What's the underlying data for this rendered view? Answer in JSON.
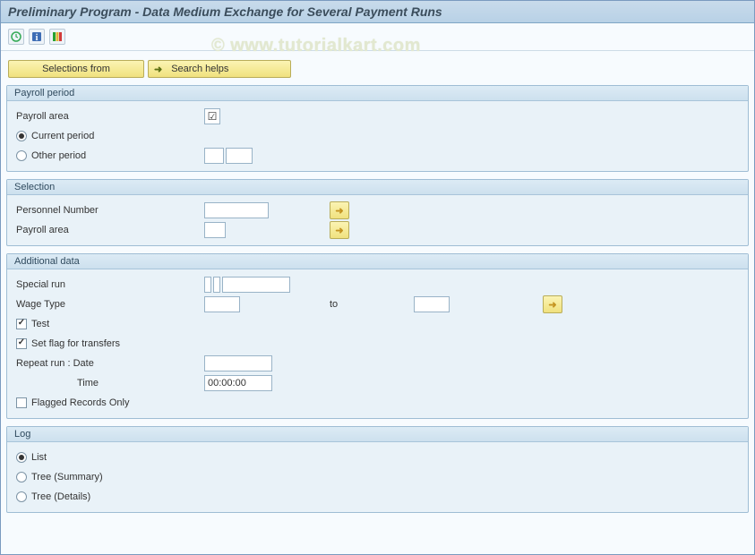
{
  "title": "Preliminary Program - Data Medium Exchange for Several Payment Runs",
  "watermark": "www.tutorialkart.com",
  "buttons": {
    "selectionsFrom": "Selections from",
    "searchHelps": "Search helps"
  },
  "groups": {
    "payrollPeriod": {
      "title": "Payroll period",
      "payrollAreaLabel": "Payroll area",
      "payrollAreaChecked": true,
      "currentPeriod": "Current period",
      "otherPeriod": "Other period",
      "selected": "current"
    },
    "selection": {
      "title": "Selection",
      "personnelNumber": "Personnel Number",
      "payrollArea": "Payroll area"
    },
    "additionalData": {
      "title": "Additional data",
      "specialRun": "Special run",
      "wageType": "Wage Type",
      "to": "to",
      "test": "Test",
      "testChecked": true,
      "setFlag": "Set flag for transfers",
      "setFlagChecked": true,
      "repeatRunDate": "Repeat run      : Date",
      "timeLabel": "Time",
      "timeValue": "00:00:00",
      "flaggedOnly": "Flagged Records Only",
      "flaggedOnlyChecked": false
    },
    "log": {
      "title": "Log",
      "list": "List",
      "treeSummary": "Tree (Summary)",
      "treeDetails": "Tree (Details)",
      "selected": "list"
    }
  }
}
